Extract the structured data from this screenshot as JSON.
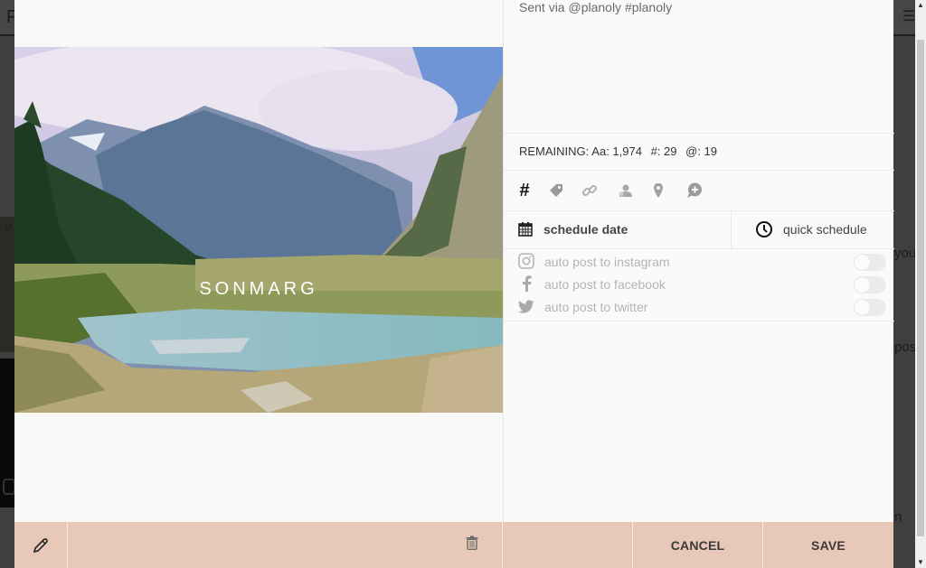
{
  "background": {
    "header_letter": "F",
    "menu_icon": "hamburger-icon",
    "left_strip_text": "U",
    "right_fragments": [
      "you",
      "pos",
      "n"
    ]
  },
  "post": {
    "caption": "Sent via @planoly #planoly",
    "image_overlay_text": "SONMARG",
    "remaining": {
      "label": "REMAINING:",
      "chars": "Aa: 1,974",
      "hashtags": "#: 29",
      "mentions": "@: 19"
    },
    "tools": [
      {
        "name": "hashtag",
        "icon": "hashtag-icon",
        "glyph": "#"
      },
      {
        "name": "tag",
        "icon": "tag-icon"
      },
      {
        "name": "link",
        "icon": "link-icon"
      },
      {
        "name": "user-tag",
        "icon": "user-tag-icon"
      },
      {
        "name": "location",
        "icon": "location-pin-icon"
      },
      {
        "name": "comment",
        "icon": "add-comment-icon"
      }
    ],
    "schedule": {
      "date_label": "schedule date",
      "quick_label": "quick schedule"
    },
    "autopost": [
      {
        "label": "auto post to instagram",
        "icon": "instagram-icon",
        "enabled": false
      },
      {
        "label": "auto post to facebook",
        "icon": "facebook-icon",
        "enabled": false
      },
      {
        "label": "auto post to twitter",
        "icon": "twitter-icon",
        "enabled": false
      }
    ]
  },
  "footer": {
    "edit_icon": "pencil-icon",
    "delete_icon": "trash-icon",
    "cancel_label": "CANCEL",
    "save_label": "SAVE"
  },
  "colors": {
    "footer_bg": "#e8c8b8",
    "overlay_bg": "#3f3f3d"
  }
}
